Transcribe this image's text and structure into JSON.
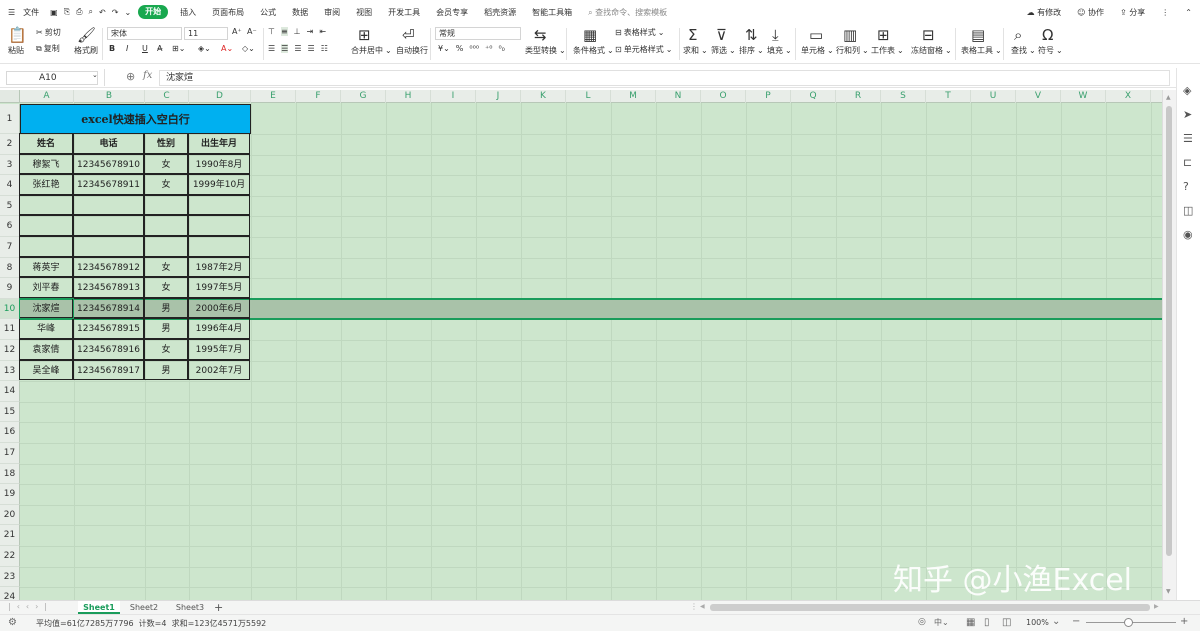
{
  "menu": {
    "file": "文件",
    "tabs": [
      "开始",
      "插入",
      "页面布局",
      "公式",
      "数据",
      "审阅",
      "视图",
      "开发工具",
      "会员专享",
      "稻壳资源",
      "智能工具箱"
    ],
    "active_tab": "开始",
    "search_placeholder": "查找命令、搜索模板",
    "right": [
      "有修改",
      "协作",
      "分享"
    ]
  },
  "ribbon": {
    "cut": "剪切",
    "paste": "粘贴",
    "copy": "复制",
    "format_painter": "格式刷",
    "font_name": "宋体",
    "font_size": "11",
    "merge_center": "合并居中",
    "auto_wrap": "自动换行",
    "number_format": "常规",
    "type_convert": "类型转换",
    "cond_format": "条件格式",
    "table_style": "表格样式",
    "cell_style": "单元格样式",
    "sum": "求和",
    "filter": "筛选",
    "sort": "排序",
    "fill": "填充",
    "cell": "单元格",
    "row_col": "行和列",
    "worksheet": "工作表",
    "freeze": "冻结窗格",
    "table_tools": "表格工具",
    "find": "查找",
    "symbol": "符号"
  },
  "formula_bar": {
    "name_box": "A10",
    "fx": "fx",
    "content": "沈家煊"
  },
  "columns": [
    "A",
    "B",
    "C",
    "D",
    "E",
    "F",
    "G",
    "H",
    "I",
    "J",
    "K",
    "L",
    "M",
    "N",
    "O",
    "P",
    "Q",
    "R",
    "S",
    "T",
    "U",
    "V",
    "W",
    "X"
  ],
  "rows": [
    "1",
    "2",
    "3",
    "4",
    "5",
    "6",
    "7",
    "8",
    "9",
    "10",
    "11",
    "12",
    "13",
    "14",
    "15",
    "16",
    "17",
    "18",
    "19",
    "20",
    "21",
    "22",
    "23",
    "24"
  ],
  "sheet": {
    "title": "excel快速插入空白行",
    "headers": [
      "姓名",
      "电话",
      "性别",
      "出生年月"
    ],
    "data": [
      [
        "穆絮飞",
        "12345678910",
        "女",
        "1990年8月"
      ],
      [
        "张红艳",
        "12345678911",
        "女",
        "1999年10月"
      ],
      [
        "",
        "",
        "",
        ""
      ],
      [
        "",
        "",
        "",
        ""
      ],
      [
        "",
        "",
        "",
        ""
      ],
      [
        "蒋英宇",
        "12345678912",
        "女",
        "1987年2月"
      ],
      [
        "刘平春",
        "12345678913",
        "女",
        "1997年5月"
      ],
      [
        "沈家煊",
        "12345678914",
        "男",
        "2000年6月"
      ],
      [
        "华峰",
        "12345678915",
        "男",
        "1996年4月"
      ],
      [
        "袁家倩",
        "12345678916",
        "女",
        "1995年7月"
      ],
      [
        "吴全峰",
        "12345678917",
        "男",
        "2002年7月"
      ]
    ]
  },
  "sheet_tabs": [
    "Sheet1",
    "Sheet2",
    "Sheet3"
  ],
  "active_sheet": "Sheet1",
  "status": {
    "stats": "平均值=61亿7285万7796  计数=4  求和=123亿4571万5592",
    "zoom": "100%"
  },
  "watermark": "知乎 @小渔Excel",
  "colors": {
    "accent": "#19a84f",
    "title_fill": "#00b0f0",
    "grid_bg": "#cde6cd",
    "selected_row": "#a9c2a9"
  }
}
